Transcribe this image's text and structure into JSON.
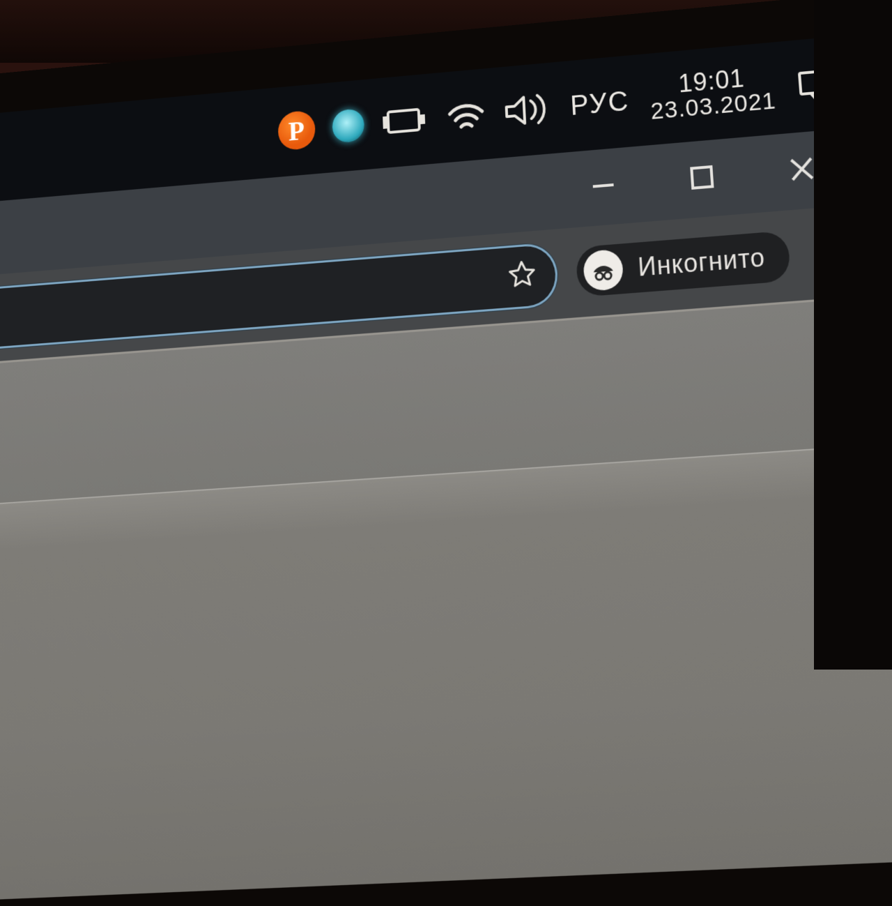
{
  "taskbar": {
    "p_icon_letter": "P",
    "language": "РУС",
    "time": "19:01",
    "date": "23.03.2021"
  },
  "browser": {
    "incognito_label": "Инкогнито"
  }
}
